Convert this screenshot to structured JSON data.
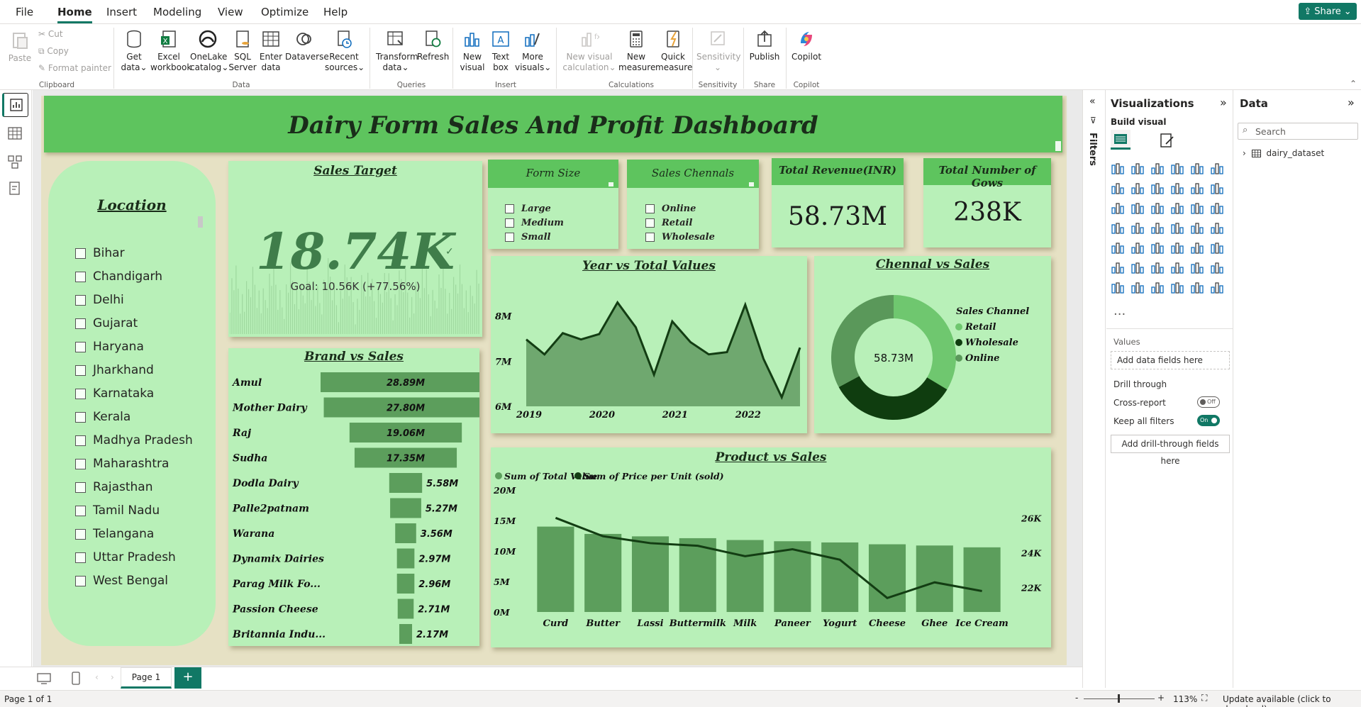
{
  "menu": {
    "items": [
      "File",
      "Home",
      "Insert",
      "Modeling",
      "View",
      "Optimize",
      "Help"
    ],
    "active": "Home",
    "share": "Share"
  },
  "ribbon": {
    "clipboard": {
      "paste": "Paste",
      "cut": "Cut",
      "copy": "Copy",
      "format_painter": "Format painter",
      "group": "Clipboard"
    },
    "data": {
      "get_data": [
        "Get",
        "data"
      ],
      "excel": [
        "Excel",
        "workbook"
      ],
      "onelake": [
        "OneLake",
        "catalog"
      ],
      "sql": [
        "SQL",
        "Server"
      ],
      "enter": [
        "Enter",
        "data"
      ],
      "dataverse": [
        "Dataverse"
      ],
      "recent": [
        "Recent",
        "sources"
      ],
      "group": "Data"
    },
    "queries": {
      "transform": [
        "Transform",
        "data"
      ],
      "refresh": [
        "Refresh"
      ],
      "group": "Queries"
    },
    "insert": {
      "new_visual": [
        "New",
        "visual"
      ],
      "text_box": [
        "Text",
        "box"
      ],
      "more_visuals": [
        "More",
        "visuals"
      ],
      "group": "Insert"
    },
    "calculations": {
      "new_visual_calc": [
        "New visual",
        "calculation"
      ],
      "new_measure": [
        "New",
        "measure"
      ],
      "quick_measure": [
        "Quick",
        "measure"
      ],
      "group": "Calculations"
    },
    "sensitivity": {
      "label": "Sensitivity",
      "group": "Sensitivity"
    },
    "share": {
      "publish": "Publish",
      "group": "Share"
    },
    "copilot": {
      "label": "Copilot",
      "group": "Copilot"
    }
  },
  "dashboard": {
    "title": "Dairy Form Sales And Profit Dashboard",
    "location": {
      "title": "Location",
      "items": [
        "Bihar",
        "Chandigarh",
        "Delhi",
        "Gujarat",
        "Haryana",
        "Jharkhand",
        "Karnataka",
        "Kerala",
        "Madhya Pradesh",
        "Maharashtra",
        "Rajasthan",
        "Tamil Nadu",
        "Telangana",
        "Uttar Pradesh",
        "West Bengal"
      ]
    },
    "sales_target": {
      "title": "Sales Target",
      "value": "18.74K",
      "goal": "Goal: 10.56K (+77.56%)"
    },
    "form_size": {
      "title": "Form Size",
      "items": [
        "Large",
        "Medium",
        "Small"
      ]
    },
    "sales_channels": {
      "title": "Sales Chennals",
      "items": [
        "Online",
        "Retail",
        "Wholesale"
      ]
    },
    "total_revenue": {
      "title": "Total Revenue(INR)",
      "value": "58.73M"
    },
    "total_cows": {
      "title": "Total Number of Gows",
      "value": "238K"
    },
    "year_chart_title": "Year vs Total Values",
    "channel_chart_title": "Chennal vs Sales",
    "brand_chart_title": "Brand vs Sales",
    "product_chart_title": "Product vs Sales"
  },
  "chart_data": [
    {
      "type": "bar",
      "orientation": "horizontal",
      "title": "Brand vs Sales",
      "categories": [
        "Amul",
        "Mother Dairy",
        "Raj",
        "Sudha",
        "Dodla Dairy",
        "Palle2patnam",
        "Warana",
        "Dynamix Dairies",
        "Parag Milk Fo...",
        "Passion Cheese",
        "Britannia Indu..."
      ],
      "values": [
        28.89,
        27.8,
        19.06,
        17.35,
        5.58,
        5.27,
        3.56,
        2.97,
        2.96,
        2.71,
        2.17
      ],
      "labels": [
        "28.89M",
        "27.80M",
        "19.06M",
        "17.35M",
        "5.58M",
        "5.27M",
        "3.56M",
        "2.97M",
        "2.96M",
        "2.71M",
        "2.17M"
      ],
      "color": "#5c9e5c"
    },
    {
      "type": "area",
      "title": "Year vs Total Values",
      "x": [
        2019.0,
        2019.25,
        2019.5,
        2019.75,
        2020.0,
        2020.25,
        2020.5,
        2020.75,
        2021.0,
        2021.25,
        2021.5,
        2021.75,
        2022.0,
        2022.25,
        2022.5,
        2022.75
      ],
      "values": [
        7.48,
        7.15,
        7.62,
        7.48,
        7.6,
        8.3,
        7.75,
        6.7,
        7.88,
        7.42,
        7.15,
        7.2,
        8.25,
        7.05,
        6.2,
        7.3
      ],
      "xticks": [
        "2019",
        "2020",
        "2021",
        "2022"
      ],
      "yticks": [
        "6M",
        "7M",
        "8M"
      ],
      "ylim": [
        6,
        8.7
      ],
      "color": "#6fa86f",
      "line": "#133d13"
    },
    {
      "type": "pie",
      "donut": true,
      "title": "Chennal vs Sales",
      "center_label": "58.73M",
      "legend_title": "Sales Channel",
      "labels": [
        "Retail",
        "Wholesale",
        "Online"
      ],
      "values": [
        33.6,
        33.5,
        32.9
      ],
      "colors": [
        "#6fc76f",
        "#0f3d0f",
        "#5a985a"
      ]
    },
    {
      "type": "bar",
      "title": "Product vs Sales",
      "categories": [
        "Curd",
        "Butter",
        "Lassi",
        "Buttermilk",
        "Milk",
        "Paneer",
        "Yogurt",
        "Cheese",
        "Ghee",
        "Ice Cream"
      ],
      "series": [
        {
          "name": "Sum of Total Value",
          "values": [
            14.0,
            12.8,
            12.4,
            12.1,
            11.8,
            11.6,
            11.4,
            11.1,
            10.9,
            10.6
          ],
          "color": "#5c9e5c"
        },
        {
          "name": "Sum of Price per Unit (sold)",
          "values": [
            26.0,
            24.95,
            24.55,
            24.4,
            23.8,
            24.2,
            23.6,
            21.4,
            22.3,
            21.8
          ],
          "color": "#133d13",
          "axis": "right"
        }
      ],
      "yticks": [
        "0M",
        "5M",
        "10M",
        "15M",
        "20M"
      ],
      "ylim": [
        0,
        20
      ],
      "y2ticks": [
        "22K",
        "24K",
        "26K"
      ],
      "y2lim": [
        20.6,
        27.6
      ]
    }
  ],
  "panes": {
    "filters": "Filters",
    "visualizations": {
      "title": "Visualizations",
      "build": "Build visual",
      "values": "Values",
      "add_data": "Add data fields here",
      "drill": "Drill through",
      "cross": "Cross-report",
      "cross_state": "Off",
      "keep": "Keep all filters",
      "keep_state": "On",
      "add_drill": "Add drill-through fields here"
    },
    "data": {
      "title": "Data",
      "search": "Search",
      "table": "dairy_dataset"
    }
  },
  "bottom": {
    "page": "Page 1",
    "status": "Page 1 of 1",
    "zoom": "113%",
    "update": "Update available (click to download)"
  }
}
